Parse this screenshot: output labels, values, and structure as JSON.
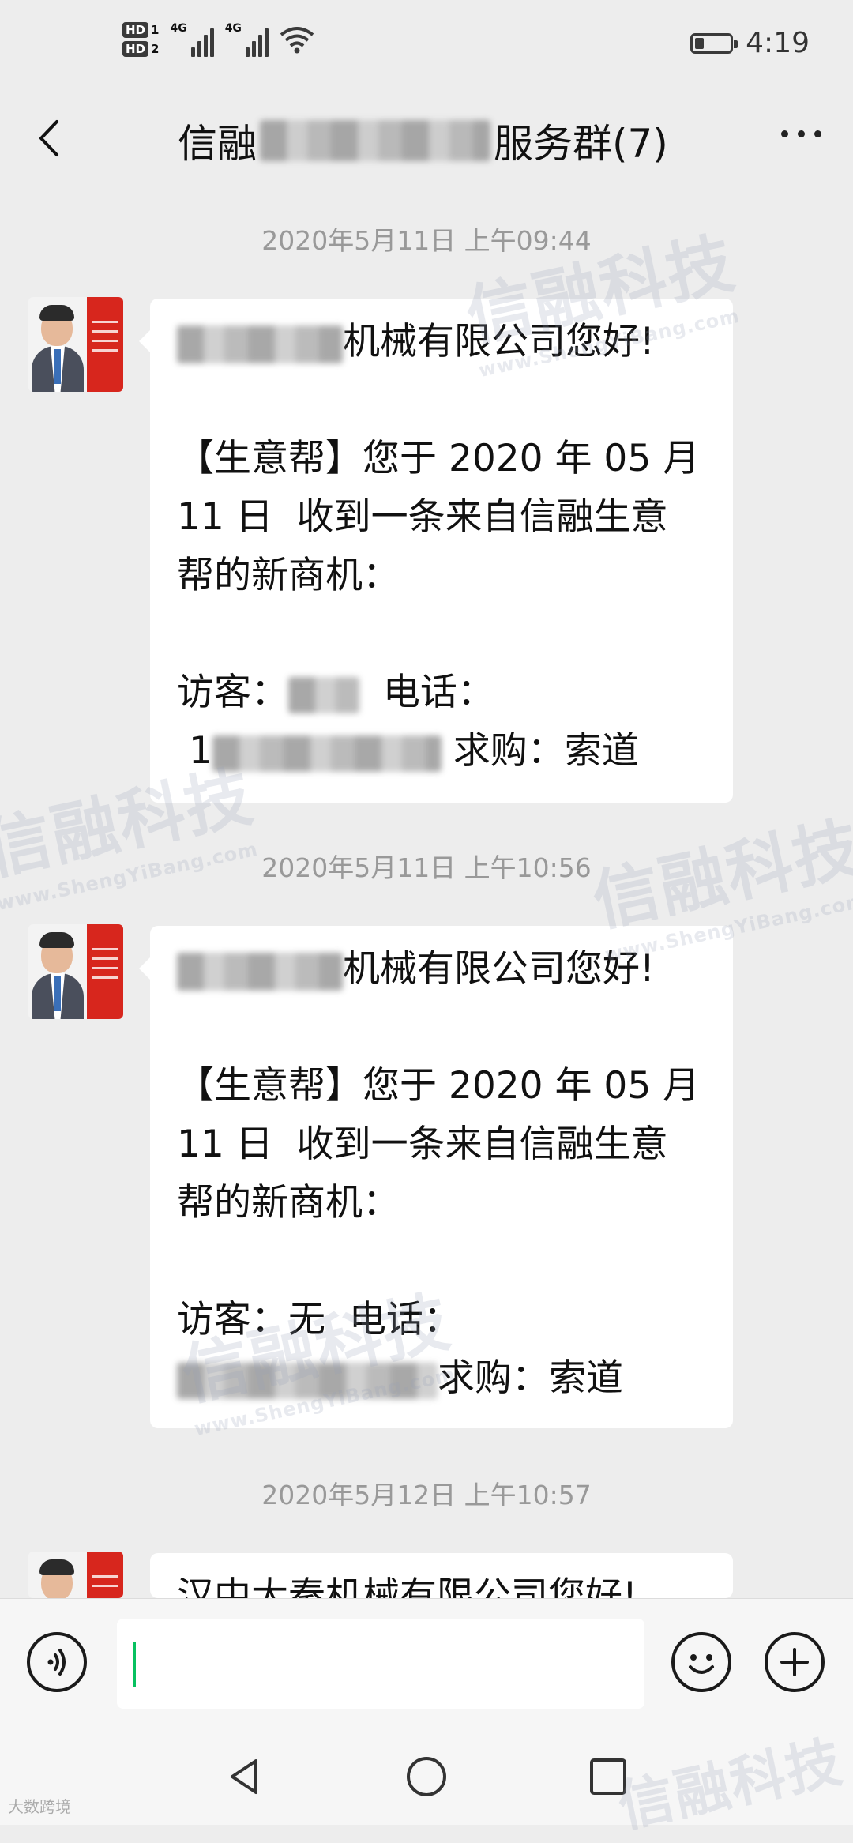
{
  "status_bar": {
    "hd1": "HD",
    "hd1_sub": "1",
    "hd2": "HD",
    "hd2_sub": "2",
    "net1": "4G",
    "net2": "4G",
    "time": "4:19",
    "battery_level": 0.25
  },
  "header": {
    "title_prefix": "信融",
    "title_suffix": "服务群(7)"
  },
  "messages": [
    {
      "timestamp": "2020年5月11日 上午09:44",
      "line1_suffix": "机械有限公司您好!",
      "body": [
        "【生意帮】您于 2020 年 05 月",
        "11 日  收到一条来自信融生意",
        "帮的新商机："
      ],
      "visitor_label": "访客：",
      "visitor_value": "",
      "visitor_tail": "",
      "phone_label": "电话：",
      "phone_prefix": "1",
      "purchase": "求购：索道"
    },
    {
      "timestamp": "2020年5月11日 上午10:56",
      "line1_suffix": "机械有限公司您好!",
      "body": [
        "【生意帮】您于 2020 年 05 月",
        "11 日  收到一条来自信融生意",
        "帮的新商机："
      ],
      "visitor_label": "访客：",
      "visitor_value": "无",
      "visitor_tail": "",
      "phone_label": "电话：",
      "phone_prefix": "",
      "purchase": "求购：索道"
    },
    {
      "timestamp": "2020年5月12日 上午10:57",
      "line1_suffix": "汉中大秦机械有限公司您好!"
    }
  ],
  "watermark": {
    "brand": "信融科技",
    "url": "www.ShengYiBang.com"
  },
  "footer_mark": "大数跨境",
  "icons": {
    "back": "back-arrow-icon",
    "more": "more-dots-icon",
    "voice": "voice-icon",
    "emoji": "emoji-icon",
    "plus": "plus-icon",
    "nav_back": "nav-back-icon",
    "nav_home": "nav-home-icon",
    "nav_recent": "nav-recent-icon"
  }
}
